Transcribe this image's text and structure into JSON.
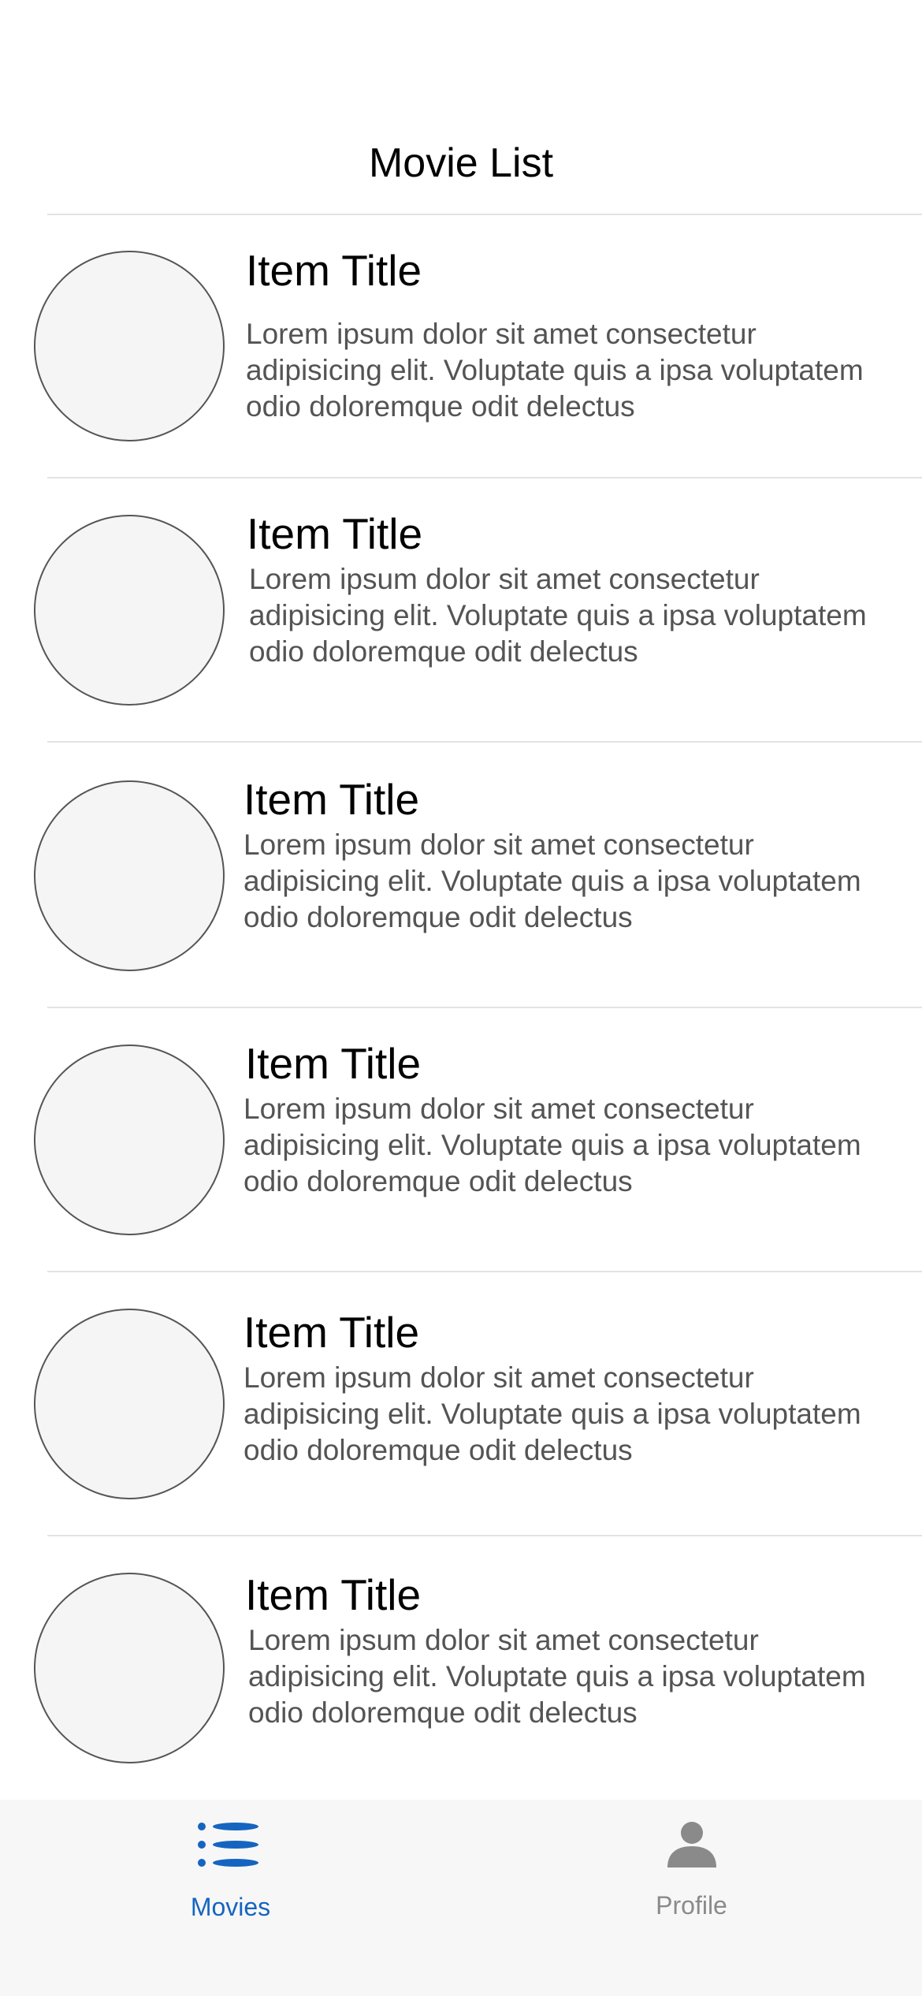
{
  "header": {
    "title": "Movie List"
  },
  "list": {
    "items": [
      {
        "title": "Item Title",
        "description": "Lorem ipsum dolor sit amet consectetur adipisicing elit. Voluptate quis a ipsa voluptatem odio doloremque odit delectus"
      },
      {
        "title": "Item Title",
        "description": "Lorem ipsum dolor sit amet consectetur adipisicing elit. Voluptate quis a ipsa voluptatem odio doloremque odit delectus"
      },
      {
        "title": "Item Title",
        "description": "Lorem ipsum dolor sit amet consectetur adipisicing elit. Voluptate quis a ipsa voluptatem odio doloremque odit delectus"
      },
      {
        "title": "Item Title",
        "description": "Lorem ipsum dolor sit amet consectetur adipisicing elit. Voluptate quis a ipsa voluptatem odio doloremque odit delectus"
      },
      {
        "title": "Item Title",
        "description": "Lorem ipsum dolor sit amet consectetur adipisicing elit. Voluptate quis a ipsa voluptatem odio doloremque odit delectus"
      },
      {
        "title": "Item Title",
        "description": "Lorem ipsum dolor sit amet consectetur adipisicing elit. Voluptate quis a ipsa voluptatem odio doloremque odit delectus"
      }
    ]
  },
  "tabbar": {
    "tabs": [
      {
        "label": "Movies",
        "icon": "list-icon",
        "active": true,
        "color": "#1565c0"
      },
      {
        "label": "Profile",
        "icon": "person-icon",
        "active": false,
        "color": "#8a8a8a"
      }
    ]
  }
}
